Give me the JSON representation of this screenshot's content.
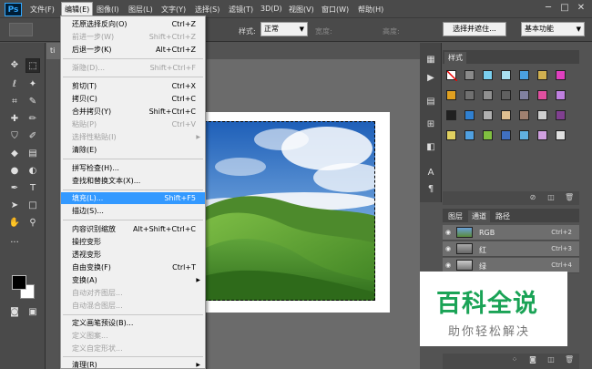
{
  "app": {
    "logo": "Ps"
  },
  "menubar": {
    "items": [
      "文件(F)",
      "编辑(E)",
      "图像(I)",
      "图层(L)",
      "文字(Y)",
      "选择(S)",
      "滤镜(T)",
      "3D(D)",
      "视图(V)",
      "窗口(W)",
      "帮助(H)"
    ],
    "active_index": 1,
    "window_controls": {
      "minimize": "─",
      "maximize": "□",
      "close": "✕"
    }
  },
  "options_bar": {
    "style_label": "样式:",
    "style_value": "正常",
    "width_label": "宽度:",
    "height_label": "高度:",
    "select_mask_button": "选择并遮住...",
    "workspace_value": "基本功能"
  },
  "document": {
    "tab_title": "ti"
  },
  "edit_menu": {
    "items": [
      {
        "label": "还原选择反向(O)",
        "shortcut": "Ctrl+Z",
        "disabled": false
      },
      {
        "label": "前进一步(W)",
        "shortcut": "Shift+Ctrl+Z",
        "disabled": true
      },
      {
        "label": "后退一步(K)",
        "shortcut": "Alt+Ctrl+Z",
        "disabled": false
      },
      {
        "label": "渐隐(D)...",
        "shortcut": "Shift+Ctrl+F",
        "disabled": true
      },
      {
        "label": "剪切(T)",
        "shortcut": "Ctrl+X",
        "disabled": false
      },
      {
        "label": "拷贝(C)",
        "shortcut": "Ctrl+C",
        "disabled": false
      },
      {
        "label": "合并拷贝(Y)",
        "shortcut": "Shift+Ctrl+C",
        "disabled": false
      },
      {
        "label": "粘贴(P)",
        "shortcut": "Ctrl+V",
        "disabled": true
      },
      {
        "label": "选择性粘贴(I)",
        "shortcut": "",
        "disabled": true,
        "submenu": true
      },
      {
        "label": "清除(E)",
        "shortcut": "",
        "disabled": false
      },
      {
        "label": "拼写检查(H)...",
        "shortcut": "",
        "disabled": false
      },
      {
        "label": "查找和替换文本(X)...",
        "shortcut": "",
        "disabled": false
      },
      {
        "label": "填充(L)...",
        "shortcut": "Shift+F5",
        "disabled": false,
        "highlighted": true
      },
      {
        "label": "描边(S)...",
        "shortcut": "",
        "disabled": false
      },
      {
        "label": "内容识别缩放",
        "shortcut": "Alt+Shift+Ctrl+C",
        "disabled": false
      },
      {
        "label": "操控变形",
        "shortcut": "",
        "disabled": false
      },
      {
        "label": "透视变形",
        "shortcut": "",
        "disabled": false
      },
      {
        "label": "自由变换(F)",
        "shortcut": "Ctrl+T",
        "disabled": false
      },
      {
        "label": "变换(A)",
        "shortcut": "",
        "disabled": false,
        "submenu": true
      },
      {
        "label": "自动对齐图层...",
        "shortcut": "",
        "disabled": true
      },
      {
        "label": "自动混合图层...",
        "shortcut": "",
        "disabled": true
      },
      {
        "label": "定义画笔预设(B)...",
        "shortcut": "",
        "disabled": false
      },
      {
        "label": "定义图案...",
        "shortcut": "",
        "disabled": true
      },
      {
        "label": "定义自定形状...",
        "shortcut": "",
        "disabled": true
      },
      {
        "label": "清理(R)",
        "shortcut": "",
        "disabled": false,
        "submenu": true
      }
    ],
    "submenu_arrow": "▶"
  },
  "styles_panel": {
    "tab": "样式"
  },
  "channels_panel": {
    "tabs": [
      "图层",
      "通道",
      "路径"
    ],
    "active_tab": 1,
    "rows": [
      {
        "name": "RGB",
        "shortcut": "Ctrl+2"
      },
      {
        "name": "红",
        "shortcut": "Ctrl+3"
      },
      {
        "name": "绿",
        "shortcut": "Ctrl+4"
      }
    ]
  },
  "watermark": {
    "main": "百科全说",
    "sub": "助你轻松解决"
  },
  "colors": {
    "dropdown_bg": "#f0f0f0",
    "highlight": "#3399ff",
    "ui_dark": "#4a4a4a",
    "watermark_green": "#1aa356"
  }
}
